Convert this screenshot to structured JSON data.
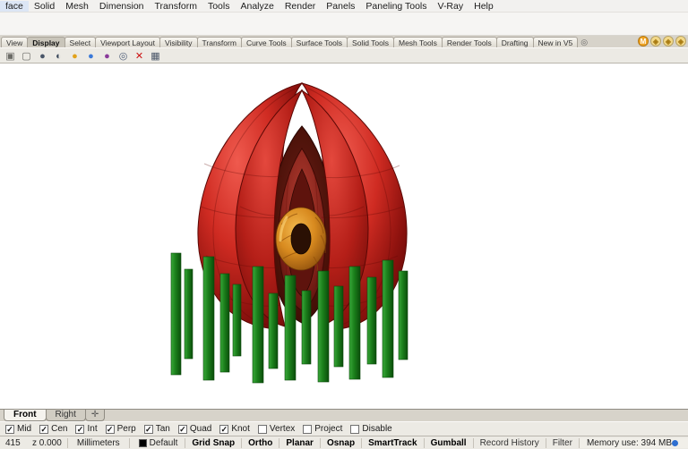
{
  "menu_bar": {
    "items": [
      "face",
      "Solid",
      "Mesh",
      "Dimension",
      "Transform",
      "Tools",
      "Analyze",
      "Render",
      "Panels",
      "Paneling Tools",
      "V-Ray",
      "Help"
    ]
  },
  "tab_bar": {
    "tabs": [
      "View",
      "Display",
      "Select",
      "Viewport Layout",
      "Visibility",
      "Transform",
      "Curve Tools",
      "Surface Tools",
      "Solid Tools",
      "Mesh Tools",
      "Render Tools",
      "Drafting",
      "New in V5"
    ],
    "active": "Display",
    "menu_glyph": "◎"
  },
  "plugin_icons": [
    {
      "name": "vray-icon",
      "glyph": "M",
      "bg": "#f0a321",
      "fg": "#ffffff"
    },
    {
      "name": "plugin-cube-icon-1",
      "glyph": "◈",
      "bg": "#f3d98a",
      "fg": "#a97b12"
    },
    {
      "name": "plugin-cube-icon-2",
      "glyph": "◈",
      "bg": "#f3d98a",
      "fg": "#a97b12"
    },
    {
      "name": "plugin-cube-icon-3",
      "glyph": "◈",
      "bg": "#f3d98a",
      "fg": "#a97b12"
    }
  ],
  "toolbar": {
    "icons": [
      {
        "name": "paste-icon",
        "glyph": "▣",
        "color": "#6b6b66"
      },
      {
        "name": "copy-icon",
        "glyph": "▢",
        "color": "#6b6b66"
      },
      {
        "name": "sphere-icon",
        "glyph": "●",
        "color": "#4a5668"
      },
      {
        "name": "half-sphere-icon",
        "glyph": "◐",
        "color": "#3d4a5c"
      },
      {
        "name": "orange-ball-icon",
        "glyph": "●",
        "color": "#e2a21a"
      },
      {
        "name": "blue-ball-icon",
        "glyph": "●",
        "color": "#3a79d8"
      },
      {
        "name": "purple-ball-icon",
        "glyph": "●",
        "color": "#8a3a9a"
      },
      {
        "name": "target-icon",
        "glyph": "◎",
        "color": "#50607a"
      },
      {
        "name": "delete-icon",
        "glyph": "✕",
        "color": "#cc1111"
      },
      {
        "name": "monitor-icon",
        "glyph": "▦",
        "color": "#4a5668"
      }
    ]
  },
  "viewport": {
    "model_colors": {
      "petal_red": "#cf2b22",
      "slat_green": "#1b7f1b",
      "ring_orange": "#d88a1f"
    }
  },
  "viewport_tabs": {
    "tabs": [
      "Front",
      "Right"
    ],
    "active": "Front",
    "add_glyph": "✛"
  },
  "osnap": {
    "items": [
      {
        "label": "Mid",
        "checked": true
      },
      {
        "label": "Cen",
        "checked": true
      },
      {
        "label": "Int",
        "checked": true
      },
      {
        "label": "Perp",
        "checked": true
      },
      {
        "label": "Tan",
        "checked": true
      },
      {
        "label": "Quad",
        "checked": true
      },
      {
        "label": "Knot",
        "checked": true
      },
      {
        "label": "Vertex",
        "checked": false
      },
      {
        "label": "Project",
        "checked": false
      },
      {
        "label": "Disable",
        "checked": false
      }
    ]
  },
  "status_bar": {
    "coord_x": "415",
    "coord_z": "z 0.000",
    "units": "Millimeters",
    "layer": "Default",
    "panes": [
      {
        "label": "Grid Snap",
        "bold": true
      },
      {
        "label": "Ortho",
        "bold": true
      },
      {
        "label": "Planar",
        "bold": true
      },
      {
        "label": "Osnap",
        "bold": true
      },
      {
        "label": "SmartTrack",
        "bold": true
      },
      {
        "label": "Gumball",
        "bold": true
      },
      {
        "label": "Record History",
        "bold": false
      },
      {
        "label": "Filter",
        "bold": false
      }
    ],
    "memory": "Memory use: 394 MB"
  }
}
